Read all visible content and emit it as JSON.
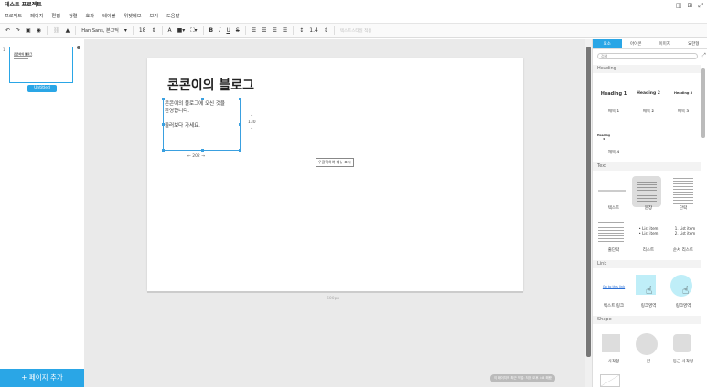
{
  "app": {
    "title": "테스트 프로젝트",
    "window_icons": [
      "split-icon",
      "grid-icon",
      "expand-icon"
    ]
  },
  "menu": [
    "프로젝트",
    "페이지",
    "편집",
    "정렬",
    "효과",
    "테이블",
    "위젯메모",
    "보기",
    "도움말"
  ],
  "toolbar": {
    "undo": "↶",
    "redo": "↷",
    "save": "▣",
    "preview": "◉",
    "lock": "🔒",
    "font_family": "Han Sans, 본고딕",
    "font_size": "18",
    "text_color_label": "A",
    "bold": "B",
    "italic": "I",
    "underline": "U",
    "strike": "S",
    "line_height": "1.4",
    "style_apply": "텍스트스타일 적용"
  },
  "pages": [
    {
      "number": "1",
      "label": "Untitled",
      "thumb_title": "콘콘이의 블로그"
    }
  ],
  "add_page_label": "+ 페이지 추가",
  "canvas": {
    "heading": "콘콘이의 블로그",
    "text_lines": [
      "콘콘이의 블로그에 오신 것을",
      "환영합니다.",
      "",
      "둘러보다 가세요."
    ],
    "selection_width": "202",
    "selection_height": "130",
    "context_chip": "우클릭하여 메뉴 표시",
    "page_width_label": "600px",
    "status_pill": "이 페이지의 최근 작업: 저장 오후 4:8 해봤"
  },
  "right_panel": {
    "tabs": [
      "요소",
      "아이콘",
      "이미지",
      "요한형"
    ],
    "active_tab": 0,
    "search_placeholder": "검색",
    "sections": [
      {
        "title": "Heading",
        "items": [
          "Heading 1",
          "Heading 2",
          "Heading 3",
          "제목 1",
          "제목 2",
          "제목 3",
          "Heading 4",
          "제목 4"
        ]
      },
      {
        "title": "Text",
        "items": [
          "텍스트",
          "문장",
          "단락",
          "줄단락",
          "리스트",
          "순서 리스트"
        ]
      },
      {
        "title": "Link",
        "items": [
          "Go to this link",
          "텍스트 링크",
          "링크영역",
          "링크영역"
        ]
      },
      {
        "title": "Shape",
        "items": [
          "사각형",
          "원",
          "둥근 사각형"
        ]
      }
    ],
    "list_items": [
      "List item",
      "List item"
    ],
    "ordered_items": [
      "1. List item",
      "2. List item"
    ]
  },
  "colors": {
    "accent": "#2aa6e6",
    "canvas_bg": "#eaeaea"
  }
}
